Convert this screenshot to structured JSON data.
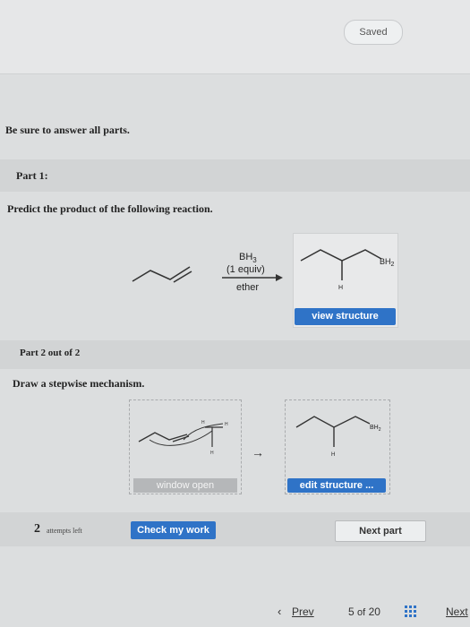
{
  "header": {
    "saved_label": "Saved"
  },
  "notice": "Be sure to answer all parts.",
  "part1": {
    "label": "Part 1:",
    "prompt": "Predict the product of the following reaction.",
    "reagent_line1": "BH",
    "reagent_line1_sub": "3",
    "reagent_line2": "(1 equiv)",
    "conditions": "ether",
    "product_label_bh": "BH",
    "product_label_bh_sub": "2",
    "product_label_h": "H",
    "view_structure_label": "view structure"
  },
  "part2": {
    "label": "Part 2 out of 2",
    "prompt": "Draw a stepwise mechanism.",
    "window_open_label": "window open",
    "edit_structure_label": "edit structure ...",
    "mech_arrow": "→",
    "right_box_bh": "BH",
    "right_box_bh_sub": "2",
    "right_box_h": "H"
  },
  "footer": {
    "attempts_number": "2",
    "attempts_label": "attempts left",
    "check_label": "Check my work",
    "next_part_label": "Next part"
  },
  "nav": {
    "prev_label": "Prev",
    "page_current": "5",
    "page_sep": "of",
    "page_total": "20",
    "next_label": "Next"
  },
  "colors": {
    "accent_blue": "#2f73c7",
    "panel_grey": "#d2d4d5",
    "background": "#dcdedf"
  },
  "icons": {
    "prev": "chevron-left-icon",
    "grid": "grid-icon"
  }
}
